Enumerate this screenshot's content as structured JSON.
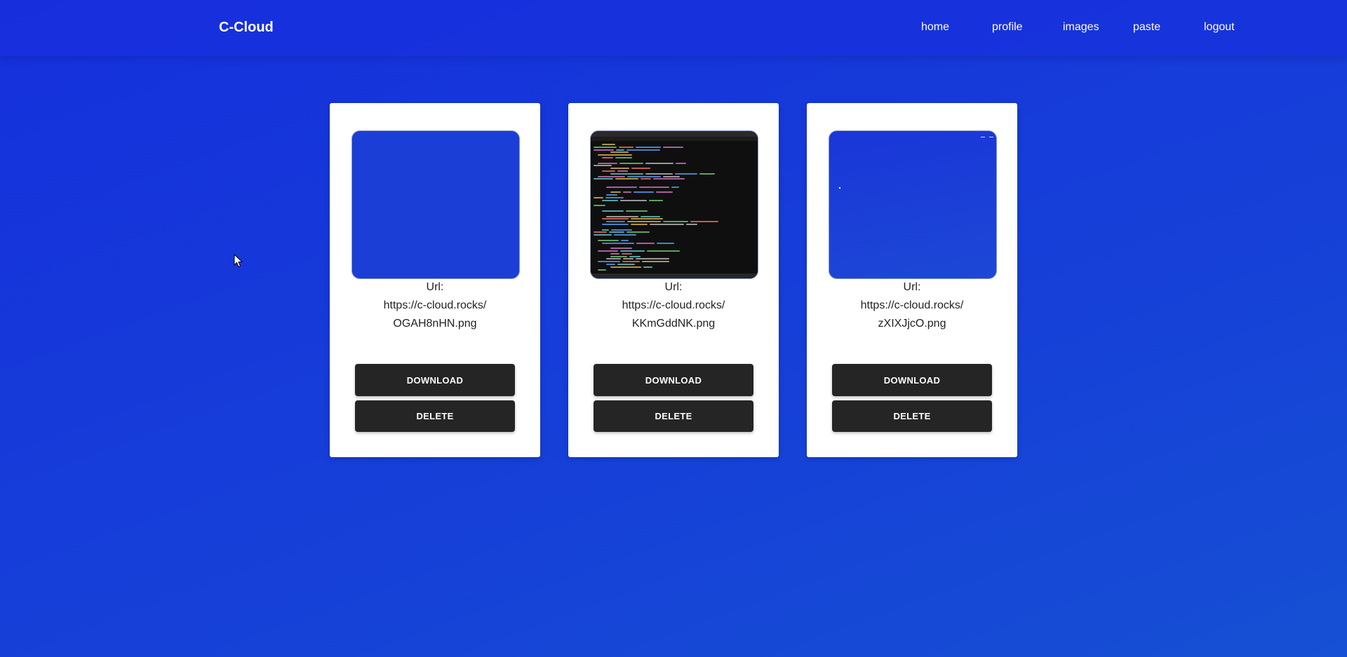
{
  "navbar": {
    "brand": "C-Cloud",
    "links": {
      "home": "home",
      "profile": "profile",
      "images": "images",
      "paste": "paste",
      "logout": "logout"
    }
  },
  "cards": [
    {
      "url_label": "Url:",
      "url_host": "https://c-cloud.rocks/",
      "url_file": "OGAH8nHN.png",
      "download_label": "DOWNLOAD",
      "delete_label": "DELETE",
      "thumbnail": "blue-image"
    },
    {
      "url_label": "Url:",
      "url_host": "https://c-cloud.rocks/",
      "url_file": "KKmGddNK.png",
      "download_label": "DOWNLOAD",
      "delete_label": "DELETE",
      "thumbnail": "code-editor-screenshot"
    },
    {
      "url_label": "Url:",
      "url_host": "https://c-cloud.rocks/",
      "url_file": "zXIXJjcO.png",
      "download_label": "DOWNLOAD",
      "delete_label": "DELETE",
      "thumbnail": "blue-desktop-screenshot"
    }
  ],
  "colors": {
    "background": "#1538dc",
    "card": "#ffffff",
    "button": "#252525",
    "button_text": "#ffffff",
    "url_text": "#222222"
  },
  "icons": {
    "cursor": "mouse-pointer-icon"
  }
}
